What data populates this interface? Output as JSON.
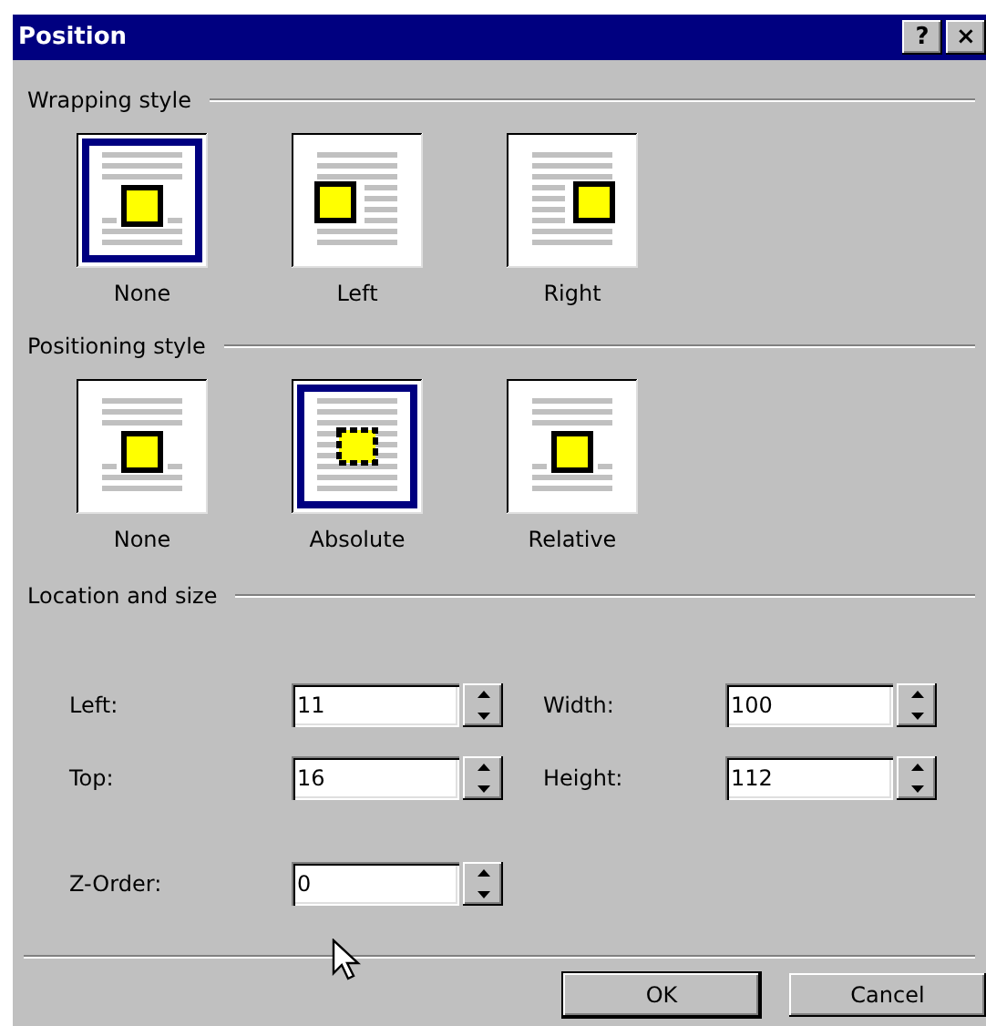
{
  "window": {
    "title": "Position",
    "help_button": "?",
    "close_button": "×"
  },
  "wrapping_style": {
    "title": "Wrapping style",
    "options": [
      {
        "label": "None",
        "kind": "none",
        "selected": true
      },
      {
        "label": "Left",
        "kind": "left",
        "selected": false
      },
      {
        "label": "Right",
        "kind": "right",
        "selected": false
      }
    ]
  },
  "positioning_style": {
    "title": "Positioning style",
    "options": [
      {
        "label": "None",
        "kind": "none",
        "selected": false
      },
      {
        "label": "Absolute",
        "kind": "absolute",
        "selected": true
      },
      {
        "label": "Relative",
        "kind": "relative",
        "selected": false
      }
    ]
  },
  "location_and_size": {
    "title": "Location and size",
    "rows": [
      [
        {
          "label": "Left:",
          "value": "11"
        },
        {
          "label": "Width:",
          "value": "100"
        }
      ],
      [
        {
          "label": "Top:",
          "value": "16"
        },
        {
          "label": "Height:",
          "value": "112"
        }
      ],
      [
        {
          "label": "Z-Order:",
          "value": "0"
        }
      ]
    ]
  },
  "buttons": [
    {
      "label": "OK",
      "default": true
    },
    {
      "label": "Cancel",
      "default": false
    }
  ]
}
